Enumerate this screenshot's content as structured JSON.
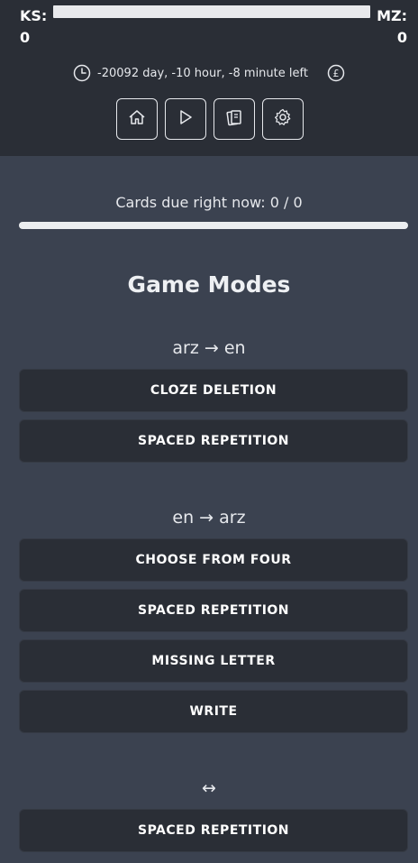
{
  "scores": {
    "left_label": "KS:",
    "left_value": "0",
    "right_label": "MZ:",
    "right_value": "0"
  },
  "timer": {
    "clock_icon": "clock-icon",
    "text": "-20092 day, -10 hour, -8 minute left",
    "currency_icon": "pound-coin-icon"
  },
  "nav": {
    "buttons": [
      {
        "icon": "home-icon"
      },
      {
        "icon": "play-icon"
      },
      {
        "icon": "cards-icon"
      },
      {
        "icon": "gear-icon"
      }
    ]
  },
  "due": {
    "text": "Cards due right now: 0 / 0",
    "progress": 0
  },
  "title": "Game Modes",
  "sections": [
    {
      "label": "arz → en",
      "modes": [
        "CLOZE DELETION",
        "SPACED REPETITION"
      ]
    },
    {
      "label": "en → arz",
      "modes": [
        "CHOOSE FROM FOUR",
        "SPACED REPETITION",
        "MISSING LETTER",
        "WRITE"
      ]
    },
    {
      "label": "↔",
      "modes": [
        "SPACED REPETITION"
      ]
    }
  ],
  "colors": {
    "header_bg": "#2a2e36",
    "page_bg": "#3b4250",
    "button_bg": "#2a2e36"
  }
}
